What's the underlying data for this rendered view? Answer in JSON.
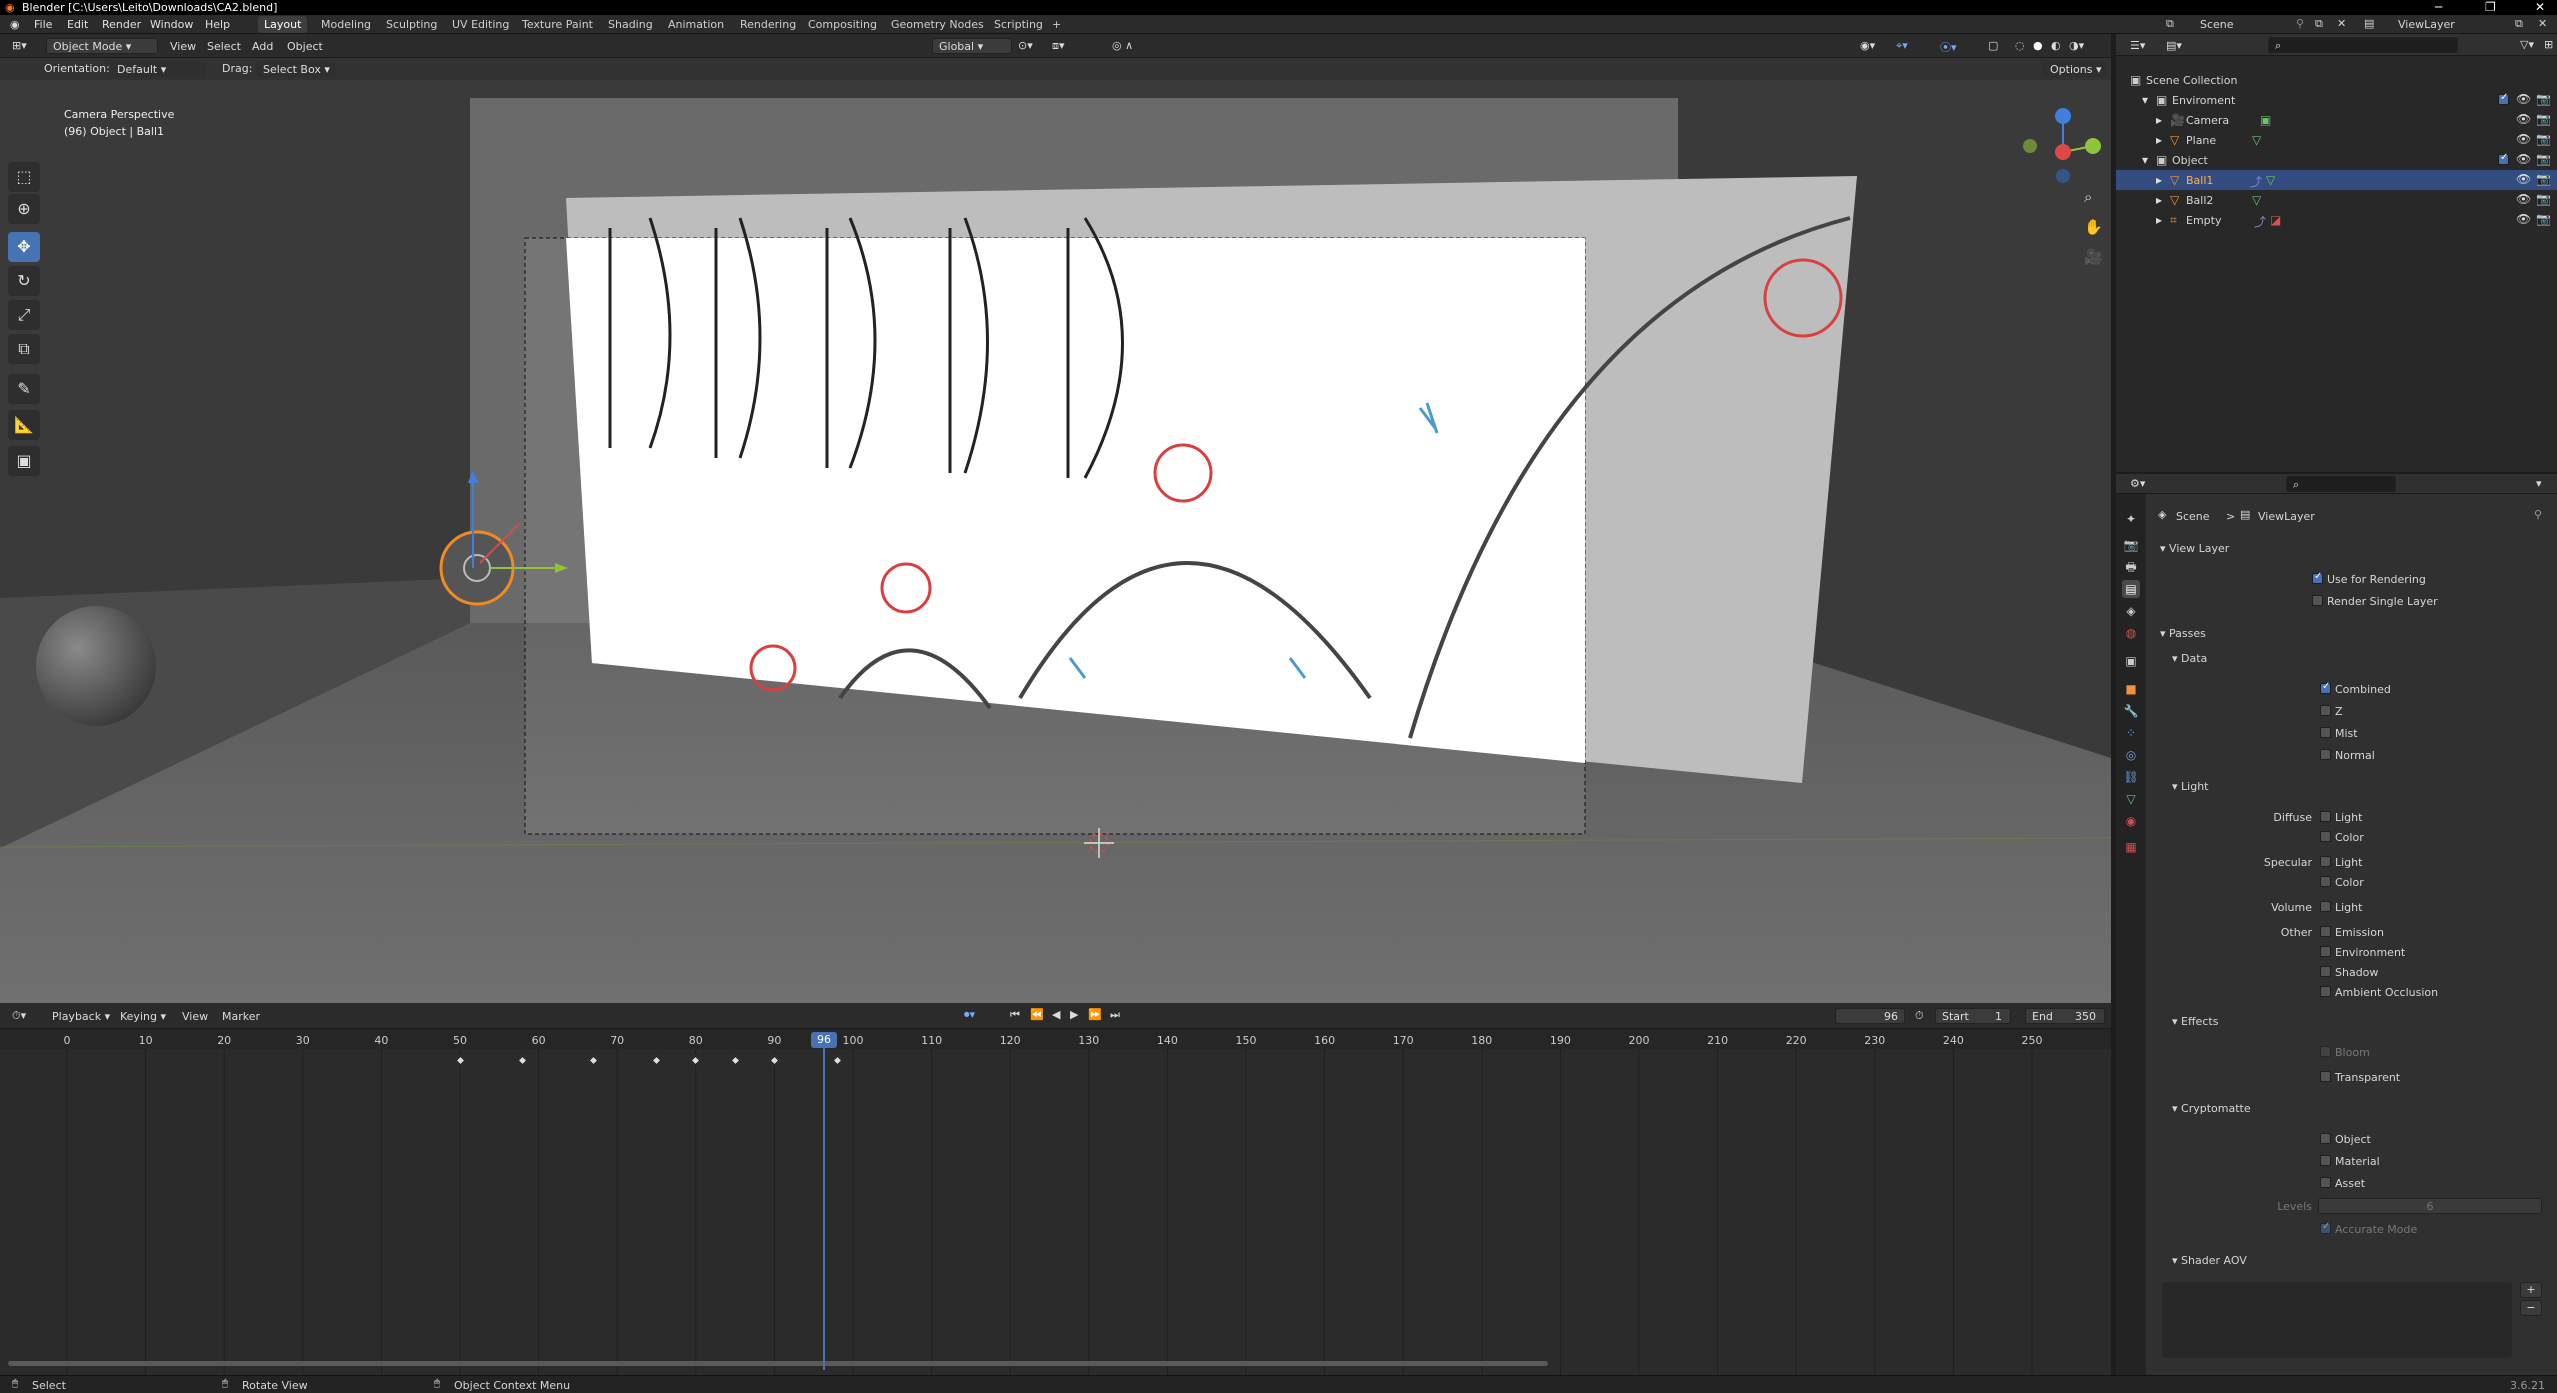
{
  "window": {
    "title": "Blender [C:\\Users\\Leito\\Downloads\\CA2.blend]"
  },
  "menu": {
    "file": "File",
    "edit": "Edit",
    "render": "Render",
    "window": "Window",
    "help": "Help"
  },
  "workspaces": [
    "Layout",
    "Modeling",
    "Sculpting",
    "UV Editing",
    "Texture Paint",
    "Shading",
    "Animation",
    "Rendering",
    "Compositing",
    "Geometry Nodes",
    "Scripting",
    "+"
  ],
  "topbar": {
    "scene": "Scene",
    "view_layer": "ViewLayer"
  },
  "viewport_header": {
    "mode": "Object Mode",
    "view": "View",
    "select": "Select",
    "add": "Add",
    "object": "Object",
    "transform": "Global",
    "orientation_label": "Orientation:",
    "orientation_value": "Default",
    "drag_label": "Drag:",
    "drag_value": "Select Box",
    "options": "Options"
  },
  "viewport": {
    "overlay_line1": "Camera Perspective",
    "overlay_line2": "(96) Object | Ball1"
  },
  "outliner": {
    "rows": [
      {
        "label": "Scene Collection"
      },
      {
        "label": "Enviroment"
      },
      {
        "label": "Camera"
      },
      {
        "label": "Plane"
      },
      {
        "label": "Object"
      },
      {
        "label": "Ball1"
      },
      {
        "label": "Ball2"
      },
      {
        "label": "Empty"
      }
    ]
  },
  "properties": {
    "breadcrumb_scene": "Scene",
    "breadcrumb_sep": ">",
    "breadcrumb_layer": "ViewLayer",
    "view_layer": {
      "title": "View Layer",
      "use_for_rendering": "Use for Rendering",
      "render_single_layer": "Render Single Layer"
    },
    "passes": {
      "title": "Passes",
      "data_title": "Data",
      "combined": "Combined",
      "z": "Z",
      "mist": "Mist",
      "normal": "Normal",
      "light_title": "Light",
      "diffuse": "Diffuse",
      "specular": "Specular",
      "volume": "Volume",
      "other": "Other",
      "light": "Light",
      "color": "Color",
      "emission": "Emission",
      "environment": "Environment",
      "shadow": "Shadow",
      "ambient_occlusion": "Ambient Occlusion"
    },
    "effects": {
      "title": "Effects",
      "bloom": "Bloom",
      "transparent": "Transparent"
    },
    "cryptomatte": {
      "title": "Cryptomatte",
      "object": "Object",
      "material": "Material",
      "asset": "Asset",
      "levels_label": "Levels",
      "levels_value": "6",
      "accurate_mode": "Accurate Mode"
    },
    "shader_aov": {
      "title": "Shader AOV"
    }
  },
  "timeline": {
    "playback": "Playback",
    "keying": "Keying",
    "view": "View",
    "marker": "Marker",
    "current_frame": "96",
    "start_label": "Start",
    "start_value": "1",
    "end_label": "End",
    "end_value": "350",
    "ticks": [
      "0",
      "10",
      "20",
      "30",
      "40",
      "50",
      "60",
      "70",
      "80",
      "90",
      "100",
      "110",
      "120",
      "130",
      "140",
      "150",
      "160",
      "170",
      "180",
      "190",
      "200",
      "210",
      "220",
      "230",
      "240",
      "250"
    ],
    "playhead_label": "96"
  },
  "statusbar": {
    "select": "Select",
    "rotate_view": "Rotate View",
    "context_menu": "Object Context Menu",
    "version": "3.6.21"
  },
  "colors": {
    "accent": "#4772b3",
    "selected_row": "#334d80",
    "header": "#303030",
    "viewport": "#3d3d3d"
  }
}
